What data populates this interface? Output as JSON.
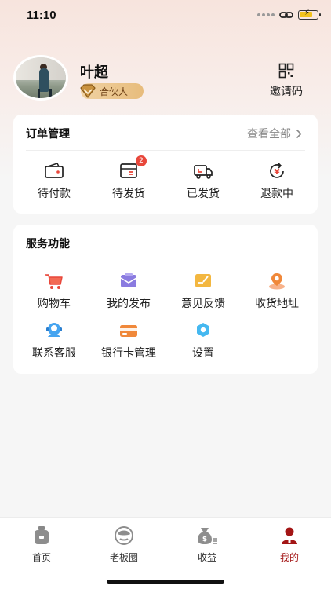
{
  "status_bar": {
    "time": "11:10"
  },
  "profile": {
    "name": "叶超",
    "badge": "合伙人",
    "invite_label": "邀请码"
  },
  "orders": {
    "title": "订单管理",
    "view_all": "查看全部",
    "items": [
      {
        "label": "待付款",
        "icon": "wallet-icon"
      },
      {
        "label": "待发货",
        "icon": "package-icon",
        "badge": "2"
      },
      {
        "label": "已发货",
        "icon": "truck-icon"
      },
      {
        "label": "退款中",
        "icon": "refund-icon"
      }
    ]
  },
  "services": {
    "title": "服务功能",
    "items": [
      {
        "label": "购物车",
        "icon": "cart-icon"
      },
      {
        "label": "我的发布",
        "icon": "publish-icon"
      },
      {
        "label": "意见反馈",
        "icon": "feedback-icon"
      },
      {
        "label": "收货地址",
        "icon": "location-icon"
      },
      {
        "label": "联系客服",
        "icon": "customer-service-icon"
      },
      {
        "label": "银行卡管理",
        "icon": "bank-card-icon"
      },
      {
        "label": "设置",
        "icon": "settings-icon"
      }
    ]
  },
  "tabs": [
    {
      "label": "首页",
      "icon": "home-icon"
    },
    {
      "label": "老板圈",
      "icon": "boss-circle-icon"
    },
    {
      "label": "收益",
      "icon": "earnings-icon"
    },
    {
      "label": "我的",
      "icon": "profile-icon",
      "active": true
    }
  ],
  "colors": {
    "accent_red": "#a31515",
    "badge_red": "#e8473b",
    "partner_gold": "#e7bc7c",
    "service_orange": "#f0883a",
    "service_purple": "#8a7be0",
    "service_yellow": "#f3b740",
    "service_blue": "#45a4f0"
  }
}
